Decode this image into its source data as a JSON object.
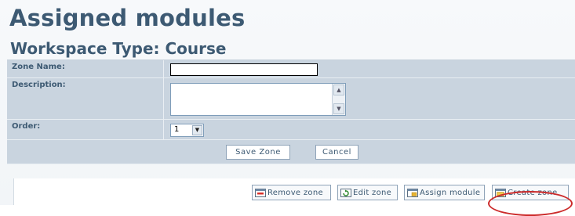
{
  "header": {
    "title": "Assigned modules",
    "subtitle": "Workspace Type: Course"
  },
  "form": {
    "zone_name_label": "Zone Name:",
    "zone_name_value": "",
    "description_label": "Description:",
    "description_value": "",
    "order_label": "Order:",
    "order_value": "1",
    "save_label": "Save Zone",
    "cancel_label": "Cancel"
  },
  "zone_toolbar": {
    "remove_label": "Remove zone",
    "edit_label": "Edit zone",
    "assign_label": "Assign module",
    "create_label": "Create zone"
  },
  "colors": {
    "heading": "#3d5a73",
    "form_bg": "#c9d4df",
    "highlight_circle": "#cc2a2a"
  }
}
